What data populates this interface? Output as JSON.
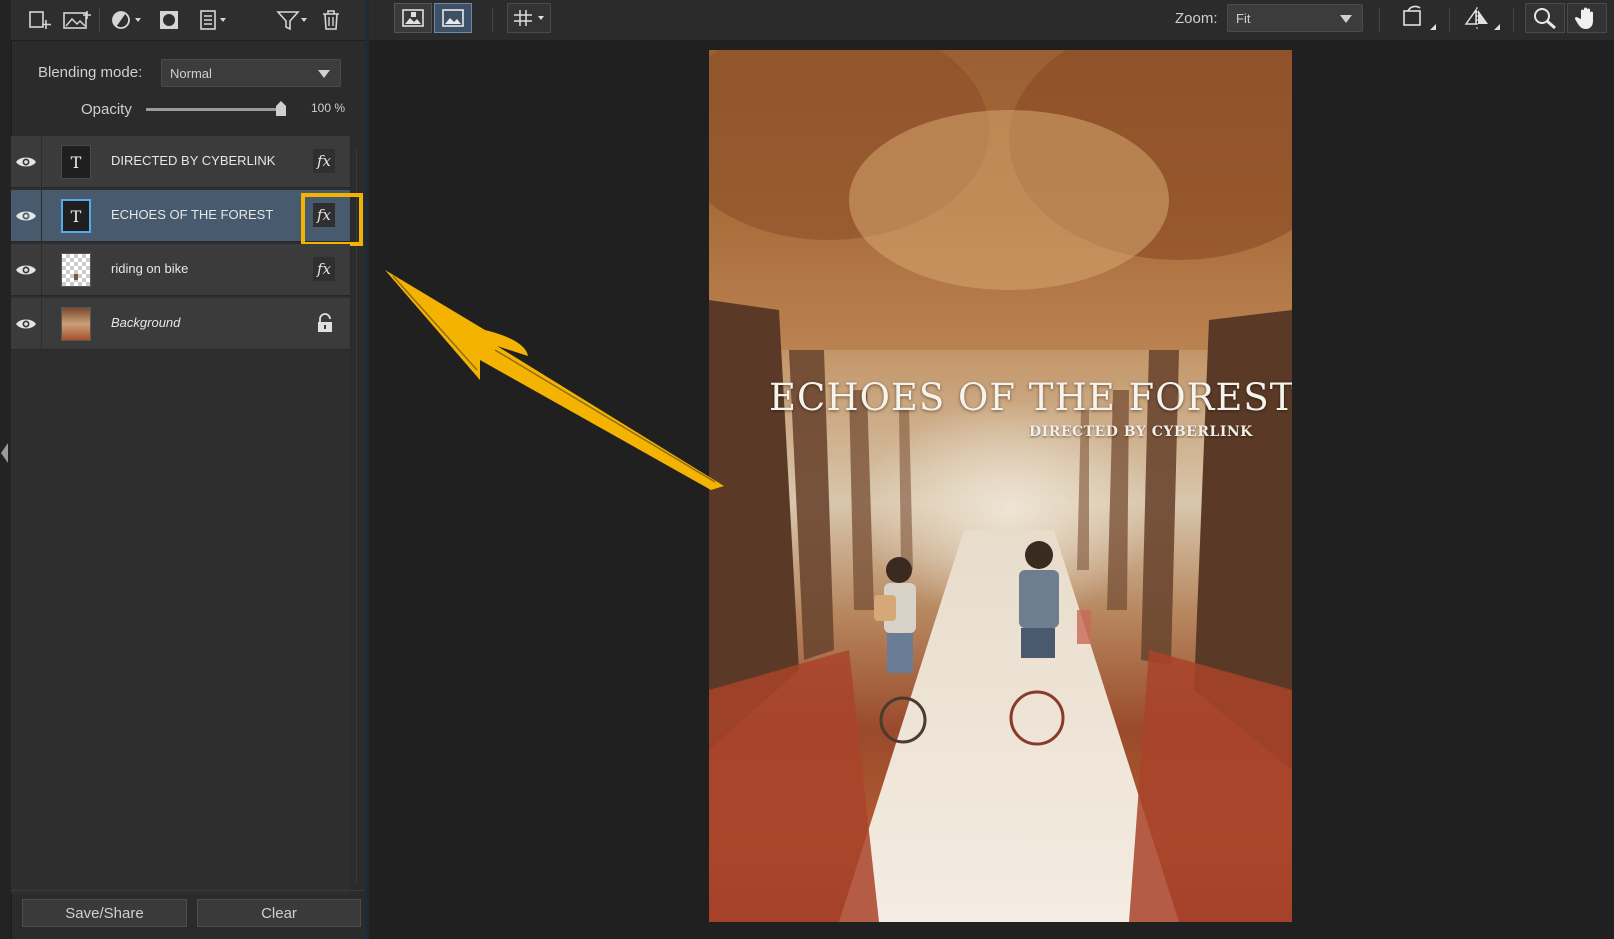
{
  "left_toolbar": {
    "icons": [
      "new-layer-icon",
      "add-image-layer-icon",
      "adjustment-icon",
      "mask-icon",
      "layer-menu-icon",
      "filter-icon",
      "trash-icon"
    ]
  },
  "layer_props": {
    "blending_label": "Blending mode:",
    "blending_value": "Normal",
    "opacity_label": "Opacity",
    "opacity_value": "100 %",
    "opacity_fraction": 1.0
  },
  "layers": [
    {
      "name": "DIRECTED BY CYBERLINK",
      "thumb": "T",
      "fx": "fx",
      "visible": true,
      "selected": false
    },
    {
      "name": "ECHOES OF THE FOREST",
      "thumb": "T",
      "fx": "fx",
      "visible": true,
      "selected": true
    },
    {
      "name": "riding on bike",
      "thumb": "",
      "fx": "fx",
      "visible": true,
      "selected": false
    },
    {
      "name": "Background",
      "thumb": "",
      "fx": "",
      "visible": true,
      "selected": false,
      "locked": true
    }
  ],
  "bottom_buttons": {
    "save": "Save/Share",
    "clear": "Clear"
  },
  "main_toolbar": {
    "zoom_label": "Zoom:",
    "zoom_value": "Fit",
    "icons": [
      "view-original-icon",
      "view-result-icon",
      "grid-icon",
      "rotate-icon",
      "flip-icon",
      "zoom-icon",
      "hand-icon"
    ]
  },
  "poster": {
    "title": "ECHOES OF THE FOREST",
    "subtitle": "DIRECTED BY CYBERLINK"
  },
  "colors": {
    "highlight": "#f5b301",
    "selected_row": "#475a6e",
    "panel": "#2b2b2b"
  }
}
